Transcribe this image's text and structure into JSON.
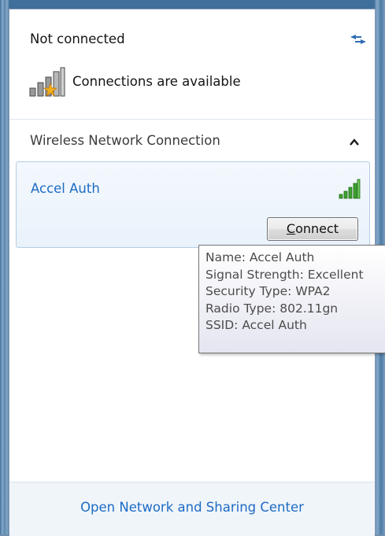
{
  "status": {
    "title": "Not connected",
    "availability": "Connections are available",
    "refresh_icon": "refresh-arrows-icon",
    "availability_icon": "signal-bars-with-star-icon"
  },
  "section": {
    "label": "Wireless Network Connection",
    "toggle_icon": "chevron-up-icon"
  },
  "network": {
    "name": "Accel Auth",
    "signal_icon": "signal-strength-excellent-icon",
    "signal_color": "#3ea32e",
    "connect_accel": "C",
    "connect_rest": "onnect"
  },
  "tooltip": {
    "lines": [
      "Name: Accel Auth",
      "Signal Strength: Excellent",
      "Security Type: WPA2",
      "Radio Type: 802.11gn",
      "SSID: Accel Auth"
    ]
  },
  "footer": {
    "link": "Open Network and Sharing Center"
  },
  "colors": {
    "link": "#1d6bc4",
    "frame": "#4d7aa3"
  }
}
